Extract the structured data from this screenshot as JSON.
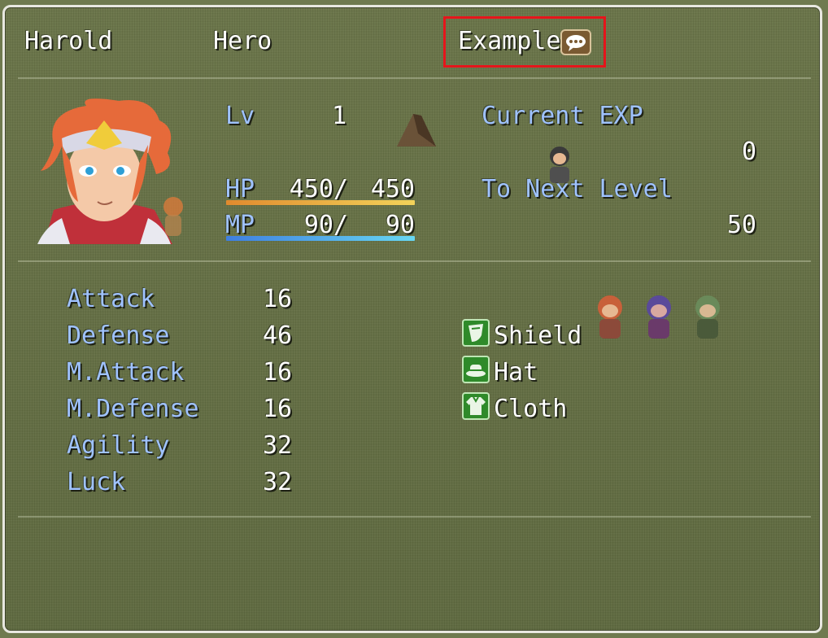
{
  "actor": {
    "name": "Harold",
    "class": "Hero",
    "nickname": "Example",
    "level_label": "Lv",
    "level": "1"
  },
  "gauges": {
    "hp_label": "HP",
    "hp_current": "450/",
    "hp_max": "450",
    "hp_fraction": 1.0,
    "mp_label": "MP",
    "mp_current": "90/",
    "mp_max": "90",
    "mp_fraction": 1.0
  },
  "exp": {
    "current_label": "Current EXP",
    "current_value": "0",
    "next_label": "To Next Level",
    "next_value": "50"
  },
  "params": [
    {
      "label": "Attack",
      "value": "16"
    },
    {
      "label": "Defense",
      "value": "46"
    },
    {
      "label": "M.Attack",
      "value": "16"
    },
    {
      "label": "M.Defense",
      "value": "16"
    },
    {
      "label": "Agility",
      "value": "32"
    },
    {
      "label": "Luck",
      "value": "32"
    }
  ],
  "equipment": [
    {
      "label": "Shield",
      "icon": "shield-icon"
    },
    {
      "label": "Hat",
      "icon": "hat-icon"
    },
    {
      "label": "Cloth",
      "icon": "cloth-icon"
    }
  ],
  "colors": {
    "system_blue": "#9fc2ff",
    "hp_gauge": [
      "#e08a2e",
      "#f3d35a"
    ],
    "mp_gauge": [
      "#3f7fe0",
      "#68d7f2"
    ],
    "highlight": "#e5151b"
  }
}
